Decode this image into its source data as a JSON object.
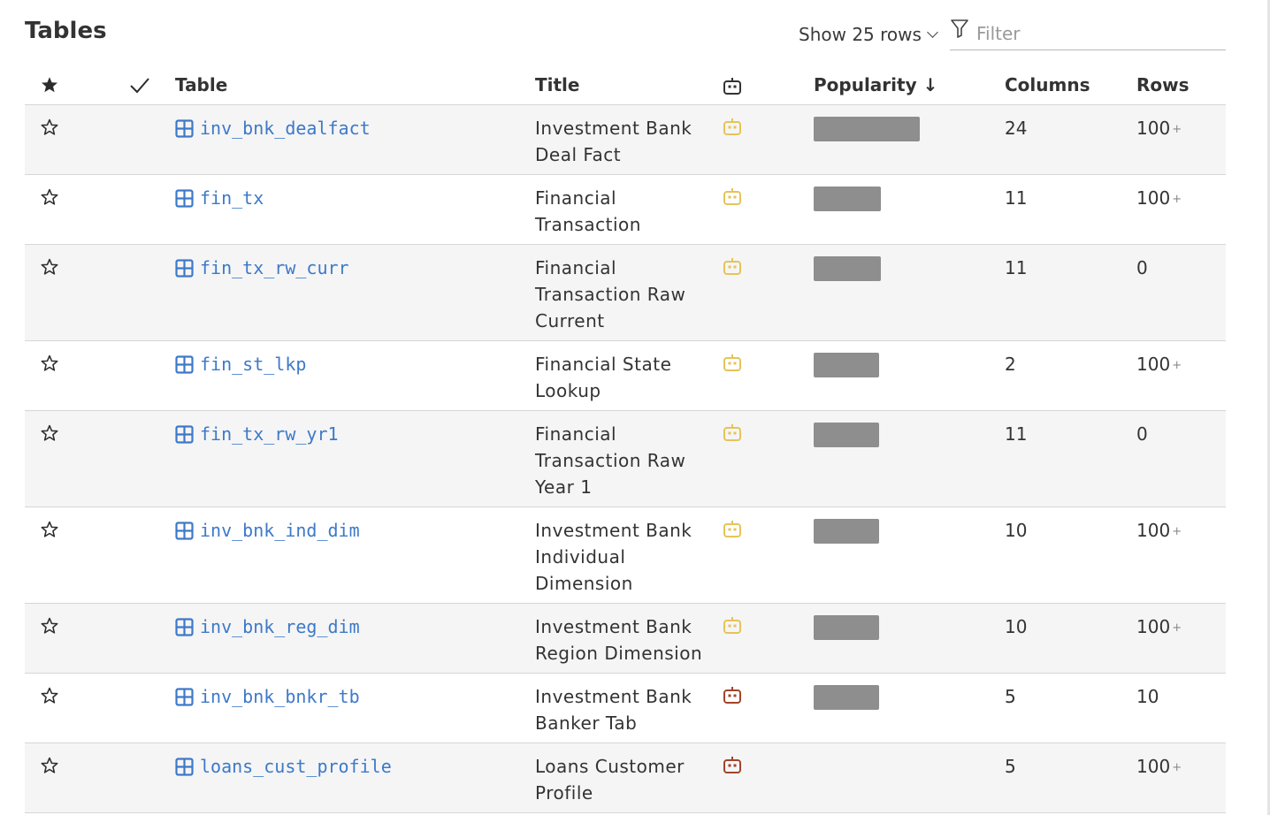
{
  "page": {
    "title": "Tables",
    "show_rows_label": "Show 25 rows",
    "filter_placeholder": "Filter"
  },
  "headers": {
    "table": "Table",
    "title": "Title",
    "popularity": "Popularity",
    "popularity_sort": "↓",
    "columns": "Columns",
    "rows": "Rows"
  },
  "colors": {
    "link": "#3d79c8",
    "bot_yellow": "#e6c35a",
    "bot_red": "#a0442c",
    "popularity_bar": "#8e8e8e"
  },
  "rows": [
    {
      "name": "inv_bnk_dealfact",
      "title": "Investment Bank Deal Fact",
      "title_lines": [
        "Investment Bank",
        "Deal Fact"
      ],
      "bot": "yellow",
      "popularity": 1.0,
      "columns": "24",
      "rows": "100",
      "rows_plus": "+"
    },
    {
      "name": "fin_tx",
      "title": "Financial Transaction",
      "title_lines": [
        "Financial",
        "Transaction"
      ],
      "bot": "yellow",
      "popularity": 0.63,
      "columns": "11",
      "rows": "100",
      "rows_plus": "+"
    },
    {
      "name": "fin_tx_rw_curr",
      "title": "Financial Transaction Raw Current",
      "title_lines": [
        "Financial",
        "Transaction Raw",
        "Current"
      ],
      "bot": "yellow",
      "popularity": 0.63,
      "columns": "11",
      "rows": "0",
      "rows_plus": ""
    },
    {
      "name": "fin_st_lkp",
      "title": "Financial State Lookup",
      "title_lines": [
        "Financial State",
        "Lookup"
      ],
      "bot": "yellow",
      "popularity": 0.62,
      "columns": "2",
      "rows": "100",
      "rows_plus": "+"
    },
    {
      "name": "fin_tx_rw_yr1",
      "title": "Financial Transaction Raw Year 1",
      "title_lines": [
        "Financial",
        "Transaction Raw",
        "Year 1"
      ],
      "bot": "yellow",
      "popularity": 0.62,
      "columns": "11",
      "rows": "0",
      "rows_plus": ""
    },
    {
      "name": "inv_bnk_ind_dim",
      "title": "Investment Bank Individual Dimension",
      "title_lines": [
        "Investment Bank",
        "Individual",
        "Dimension"
      ],
      "bot": "yellow",
      "popularity": 0.62,
      "columns": "10",
      "rows": "100",
      "rows_plus": "+"
    },
    {
      "name": "inv_bnk_reg_dim",
      "title": "Investment Bank Region Dimension",
      "title_lines": [
        "Investment Bank",
        "Region Dimension"
      ],
      "bot": "yellow",
      "popularity": 0.62,
      "columns": "10",
      "rows": "100",
      "rows_plus": "+"
    },
    {
      "name": "inv_bnk_bnkr_tb",
      "title": "Investment Bank Banker Tab",
      "title_lines": [
        "Investment Bank",
        "Banker Tab"
      ],
      "bot": "red",
      "popularity": 0.62,
      "columns": "5",
      "rows": "10",
      "rows_plus": ""
    },
    {
      "name": "loans_cust_profile",
      "title": "Loans Customer Profile",
      "title_lines": [
        "Loans Customer",
        "Profile"
      ],
      "bot": "red",
      "popularity": 0,
      "columns": "5",
      "rows": "100",
      "rows_plus": "+"
    }
  ]
}
